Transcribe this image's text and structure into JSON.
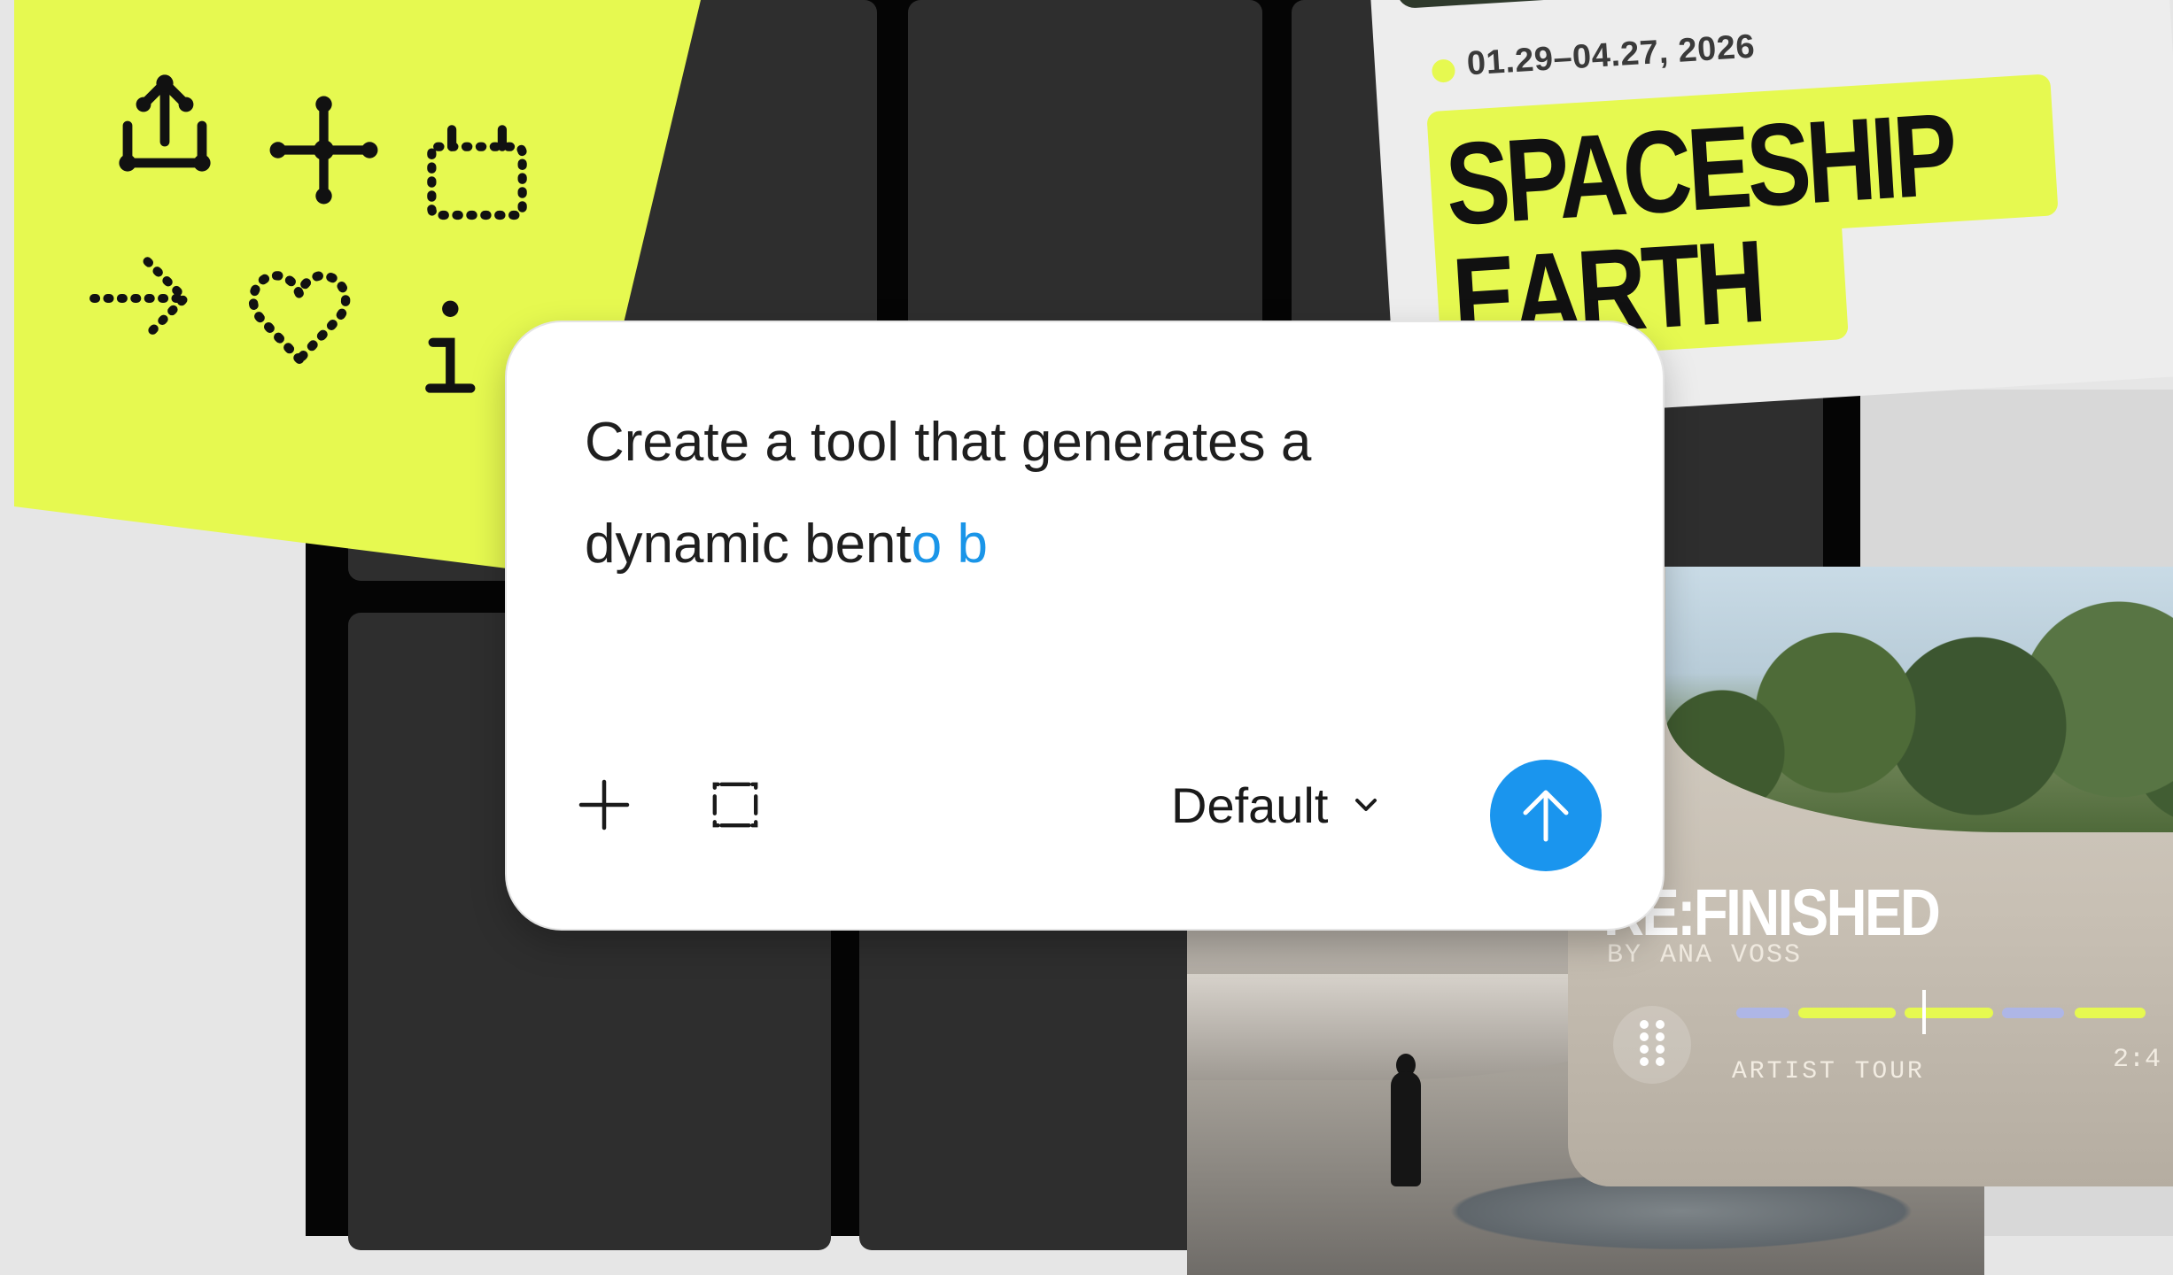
{
  "prompt": {
    "text_line1": "Create a tool that generates a",
    "text_line2_typed": "dynamic bent",
    "text_line2_suggested": "o b",
    "model_label": "Default"
  },
  "icons": {
    "add": "plus-icon",
    "frame": "frame-select-icon",
    "dropdown": "chevron-down-icon",
    "send": "arrow-up-icon"
  },
  "exhibition_card": {
    "date_range": "01.29–04.27, 2026",
    "title_line1": "SPACESHIP",
    "title_line2": "EARTH"
  },
  "music_card": {
    "title": "RE:FINISHED",
    "artist": "BY ANA VOSS",
    "tag": "ARTIST TOUR",
    "time": "2:4"
  },
  "colors": {
    "accent_blue": "#1a95ee",
    "neon_yellow": "#e6f950",
    "tile_dark": "#2e2e2e"
  }
}
